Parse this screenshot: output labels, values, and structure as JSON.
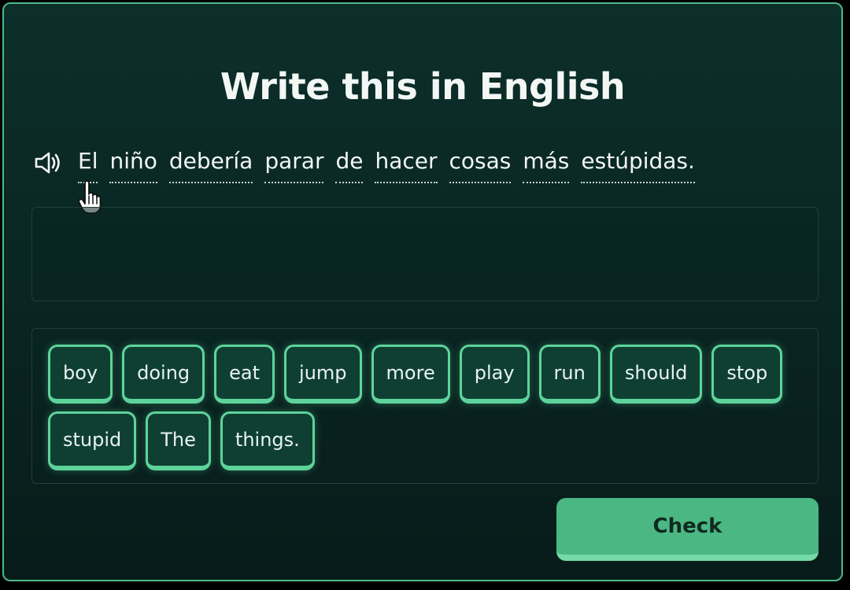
{
  "exercise": {
    "title": "Write this in English",
    "prompt_words": [
      "El",
      "niño",
      "debería",
      "parar",
      "de",
      "hacer",
      "cosas",
      "más",
      "estúpidas."
    ],
    "word_bank": [
      "boy",
      "doing",
      "eat",
      "jump",
      "more",
      "play",
      "run",
      "should",
      "stop",
      "stupid",
      "The",
      "things."
    ],
    "check_label": "Check",
    "speaker_icon": "speaker-icon",
    "accent_color": "#5dd39b",
    "button_color": "#4bb783"
  }
}
